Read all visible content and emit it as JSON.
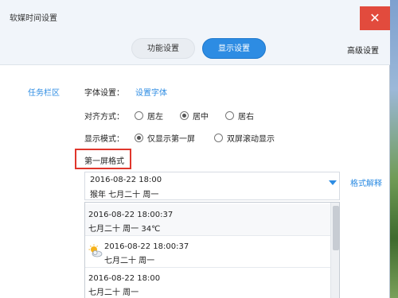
{
  "window": {
    "title": "软媒时间设置",
    "close_glyph": "✕"
  },
  "tabs": {
    "func_label": "功能设置",
    "display_label": "显示设置",
    "advanced_label": "高级设置"
  },
  "sidebar": {
    "items": [
      {
        "label": "任务栏区"
      }
    ]
  },
  "font": {
    "label": "字体设置：",
    "link": "设置字体"
  },
  "align": {
    "label": "对齐方式：",
    "options": [
      "居左",
      "居中",
      "居右"
    ],
    "selected": "居中"
  },
  "mode": {
    "label": "显示模式：",
    "options": [
      "仅显示第一屏",
      "双屏滚动显示"
    ],
    "selected": "仅显示第一屏"
  },
  "first_screen": {
    "section_label": "第一屏格式",
    "selected_line1": "2016-08-22 18:00",
    "selected_line2": "猴年 七月二十 周一",
    "help_link": "格式解释"
  },
  "dropdown": {
    "options": [
      {
        "line1": "2016-08-22 18:00:37",
        "line2": "七月二十 周一 34℃",
        "icon": ""
      },
      {
        "line1": "2016-08-22 18:00:37",
        "line2": "七月二十 周一",
        "icon": "weather-sun-cloud-icon"
      },
      {
        "line1": "2016-08-22 18:00",
        "line2": "七月二十 周一",
        "icon": ""
      }
    ]
  },
  "colors": {
    "accent": "#2d8ce3",
    "close": "#e24b3d",
    "highlight_box": "#e0362c"
  }
}
